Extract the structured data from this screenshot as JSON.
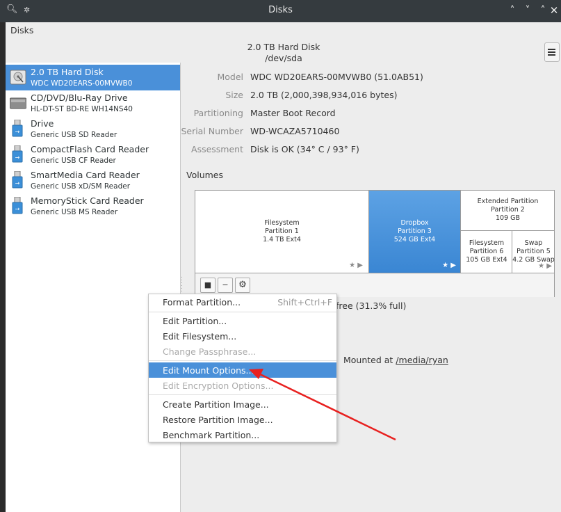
{
  "window": {
    "title": "Disks"
  },
  "app": {
    "title": "Disks"
  },
  "header": {
    "title": "2.0 TB Hard Disk",
    "subtitle": "/dev/sda"
  },
  "devices": [
    {
      "name": "2.0 TB Hard Disk",
      "sub": "WDC WD20EARS-00MVWB0",
      "icon": "hard-disk-icon",
      "selected": true
    },
    {
      "name": "CD/DVD/Blu-Ray Drive",
      "sub": "HL-DT-ST BD-RE  WH14NS40",
      "icon": "optical-drive-icon",
      "selected": false
    },
    {
      "name": "Drive",
      "sub": "Generic USB SD Reader",
      "icon": "usb-drive-icon",
      "selected": false
    },
    {
      "name": "CompactFlash Card Reader",
      "sub": "Generic USB CF Reader",
      "icon": "usb-drive-icon",
      "selected": false
    },
    {
      "name": "SmartMedia Card Reader",
      "sub": "Generic USB xD/SM Reader",
      "icon": "usb-drive-icon",
      "selected": false
    },
    {
      "name": "MemoryStick Card Reader",
      "sub": "Generic USB MS Reader",
      "icon": "usb-drive-icon",
      "selected": false
    }
  ],
  "properties": [
    {
      "label": "Model",
      "value": "WDC WD20EARS-00MVWB0 (51.0AB51)"
    },
    {
      "label": "Size",
      "value": "2.0 TB (2,000,398,934,016 bytes)"
    },
    {
      "label": "Partitioning",
      "value": "Master Boot Record"
    },
    {
      "label": "Serial Number",
      "value": "WD-WCAZA5710460"
    },
    {
      "label": "Assessment",
      "value": "Disk is OK (34° C / 93° F)"
    }
  ],
  "volumes": {
    "label": "Volumes",
    "fs": {
      "l1": "Filesystem",
      "l2": "Partition 1",
      "l3": "1.4 TB Ext4"
    },
    "dropbox": {
      "l1": "Dropbox",
      "l2": "Partition 3",
      "l3": "524 GB Ext4"
    },
    "extended": {
      "l1": "Extended Partition",
      "l2": "Partition 2",
      "l3": "109 GB"
    },
    "p6": {
      "l1": "Filesystem",
      "l2": "Partition 6",
      "l3": "105 GB Ext4"
    },
    "swap": {
      "l1": "Swap",
      "l2": "Partition 5",
      "l3": "4.2 GB Swap"
    },
    "usage_text": "free (31.3% full)",
    "mounted_text": "Mounted at",
    "mount_path": "/media/ryan"
  },
  "context_menu": {
    "format": {
      "label": "Format Partition...",
      "shortcut": "Shift+Ctrl+F"
    },
    "edit_partition": "Edit Partition...",
    "edit_filesystem": "Edit Filesystem...",
    "change_passphrase": "Change Passphrase...",
    "edit_mount": "Edit Mount Options...",
    "edit_encryption": "Edit Encryption Options...",
    "create_image": "Create Partition Image...",
    "restore_image": "Restore Partition Image...",
    "benchmark": "Benchmark Partition..."
  },
  "colors": {
    "accent": "#4a90d9",
    "annotation": "#e8201f",
    "titlebar": "#353b3f"
  }
}
